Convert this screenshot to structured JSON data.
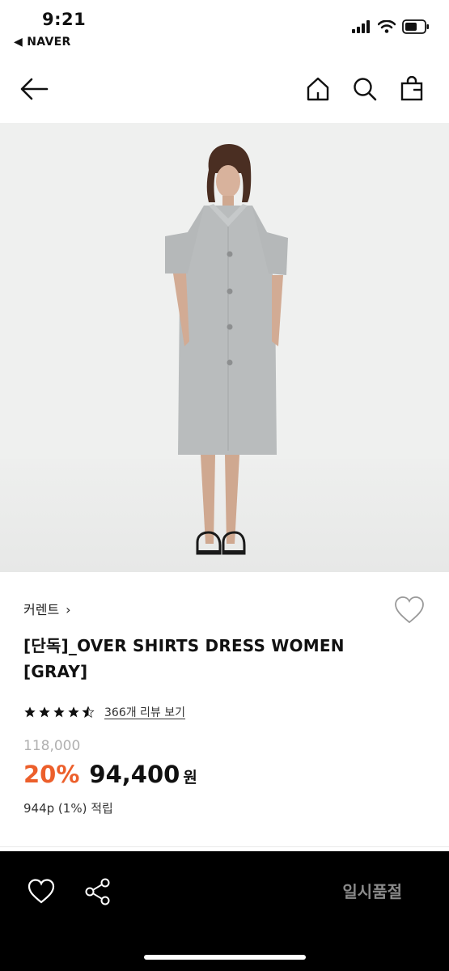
{
  "status_bar": {
    "time": "9:21",
    "back_app": "◀ NAVER",
    "icons": [
      "cellular-signal-icon",
      "wifi-icon",
      "battery-icon"
    ]
  },
  "nav": {
    "icons": [
      "back-arrow-icon",
      "home-icon",
      "search-icon",
      "shopping-bag-icon"
    ]
  },
  "product": {
    "image_alt_icon": "product-photo",
    "brand": "커렌트",
    "brand_chevron": "›",
    "title": "[단독]_OVER SHIRTS DRESS WOMEN [GRAY]",
    "rating": 4.5,
    "review_text": "366개 리뷰 보기",
    "original_price": "118,000",
    "discount": "20%",
    "price": "94,400",
    "currency": "원",
    "points": "944p (1%) 적립"
  },
  "bottom_bar": {
    "soldout_label": "일시품절",
    "icons": [
      "heart-icon",
      "share-icon"
    ]
  },
  "colors": {
    "discount": "#ec5f2b",
    "bottom_bar_bg": "#000000",
    "soldout_text": "#8a8a8a",
    "image_bg": "#eff0ef"
  }
}
